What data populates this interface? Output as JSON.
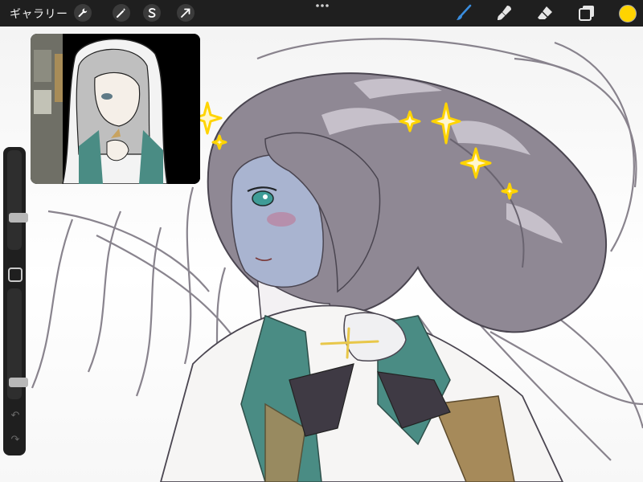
{
  "toolbar": {
    "gallery_label": "ギャラリー",
    "left_tools": [
      {
        "name": "actions",
        "icon": "wrench-icon"
      },
      {
        "name": "adjustments",
        "icon": "magic-wand-icon"
      },
      {
        "name": "selection",
        "icon": "selection-s-icon"
      },
      {
        "name": "transform",
        "icon": "arrow-cursor-icon"
      }
    ],
    "menu_icon": "more-dots-icon",
    "right_tools": [
      {
        "name": "brush",
        "icon": "brush-icon",
        "active": true
      },
      {
        "name": "smudge",
        "icon": "smudge-icon"
      },
      {
        "name": "eraser",
        "icon": "eraser-icon"
      },
      {
        "name": "layers",
        "icon": "layers-icon"
      }
    ],
    "current_color": "#FFD400"
  },
  "sidebar": {
    "brush_size_level": 0.3,
    "opacity_level": 0.12,
    "modify_icon": "square-outline-icon",
    "undo_icon": "undo-icon",
    "redo_icon": "redo-icon"
  },
  "reference_window": {
    "content": "reference-image"
  },
  "colors": {
    "toolbar_bg": "#1f1f1f",
    "accent_blue": "#3a8dde",
    "hair": "#8f8894",
    "sparkle": "#ffd400",
    "stole_teal": "#4a8c84"
  }
}
